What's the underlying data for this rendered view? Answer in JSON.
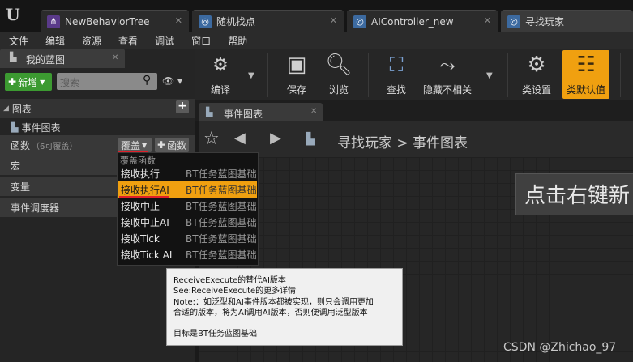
{
  "tabs": [
    {
      "label": "NewBehaviorTree",
      "icon": "behavior-tree-icon",
      "icon_color": "#5a3a8a"
    },
    {
      "label": "随机找点",
      "icon": "blueprint-icon",
      "icon_color": "#3c6aa0"
    },
    {
      "label": "AIController_new",
      "icon": "blueprint-icon",
      "icon_color": "#3c6aa0"
    },
    {
      "label": "寻找玩家",
      "icon": "blueprint-icon",
      "icon_color": "#3c6aa0"
    }
  ],
  "menu": [
    "文件",
    "编辑",
    "资源",
    "查看",
    "调试",
    "窗口",
    "帮助"
  ],
  "my_blueprint": {
    "tab_title": "我的蓝图",
    "add_label": "新增",
    "search_placeholder": "搜索",
    "graphs_label": "图表",
    "event_graph_label": "事件图表",
    "functions_label": "函数",
    "functions_note": "（6可覆盖）",
    "override_label": "覆盖",
    "add_function_label": "函数",
    "macros_label": "宏",
    "variables_label": "变量",
    "dispatchers_label": "事件调度器"
  },
  "override_menu": {
    "header": "覆盖函数",
    "items": [
      {
        "name": "接收执行",
        "sub": "BT任务蓝图基础"
      },
      {
        "name": "接收执行AI",
        "sub": "BT任务蓝图基础"
      },
      {
        "name": "接收中止",
        "sub": "BT任务蓝图基础"
      },
      {
        "name": "接收中止AI",
        "sub": "BT任务蓝图基础"
      },
      {
        "name": "接收Tick",
        "sub": "BT任务蓝图基础"
      },
      {
        "name": "接收Tick AI",
        "sub": "BT任务蓝图基础"
      }
    ],
    "highlight_color": "#f0a010"
  },
  "tooltip": {
    "line1": "ReceiveExecute的替代AI版本",
    "line2": "See:ReceiveExecute的更多详情",
    "line3": "Note:：如泛型和AI事件版本都被实现，则只会调用更加",
    "line4": "合适的版本，将为AI调用AI版本，否则便调用泛型版本",
    "line5": "目标是BT任务蓝图基础"
  },
  "toolbar": {
    "compile": "编译",
    "save": "保存",
    "browse": "浏览",
    "find": "查找",
    "hide_unrelated": "隐藏不相关",
    "class_settings": "类设置",
    "class_defaults": "类默认值"
  },
  "graph": {
    "tab_label": "事件图表",
    "breadcrumb_root": "寻找玩家",
    "breadcrumb_sep": ">",
    "breadcrumb_leaf": "事件图表",
    "hint": "点击右键新"
  },
  "watermark": "CSDN @Zhichao_97"
}
